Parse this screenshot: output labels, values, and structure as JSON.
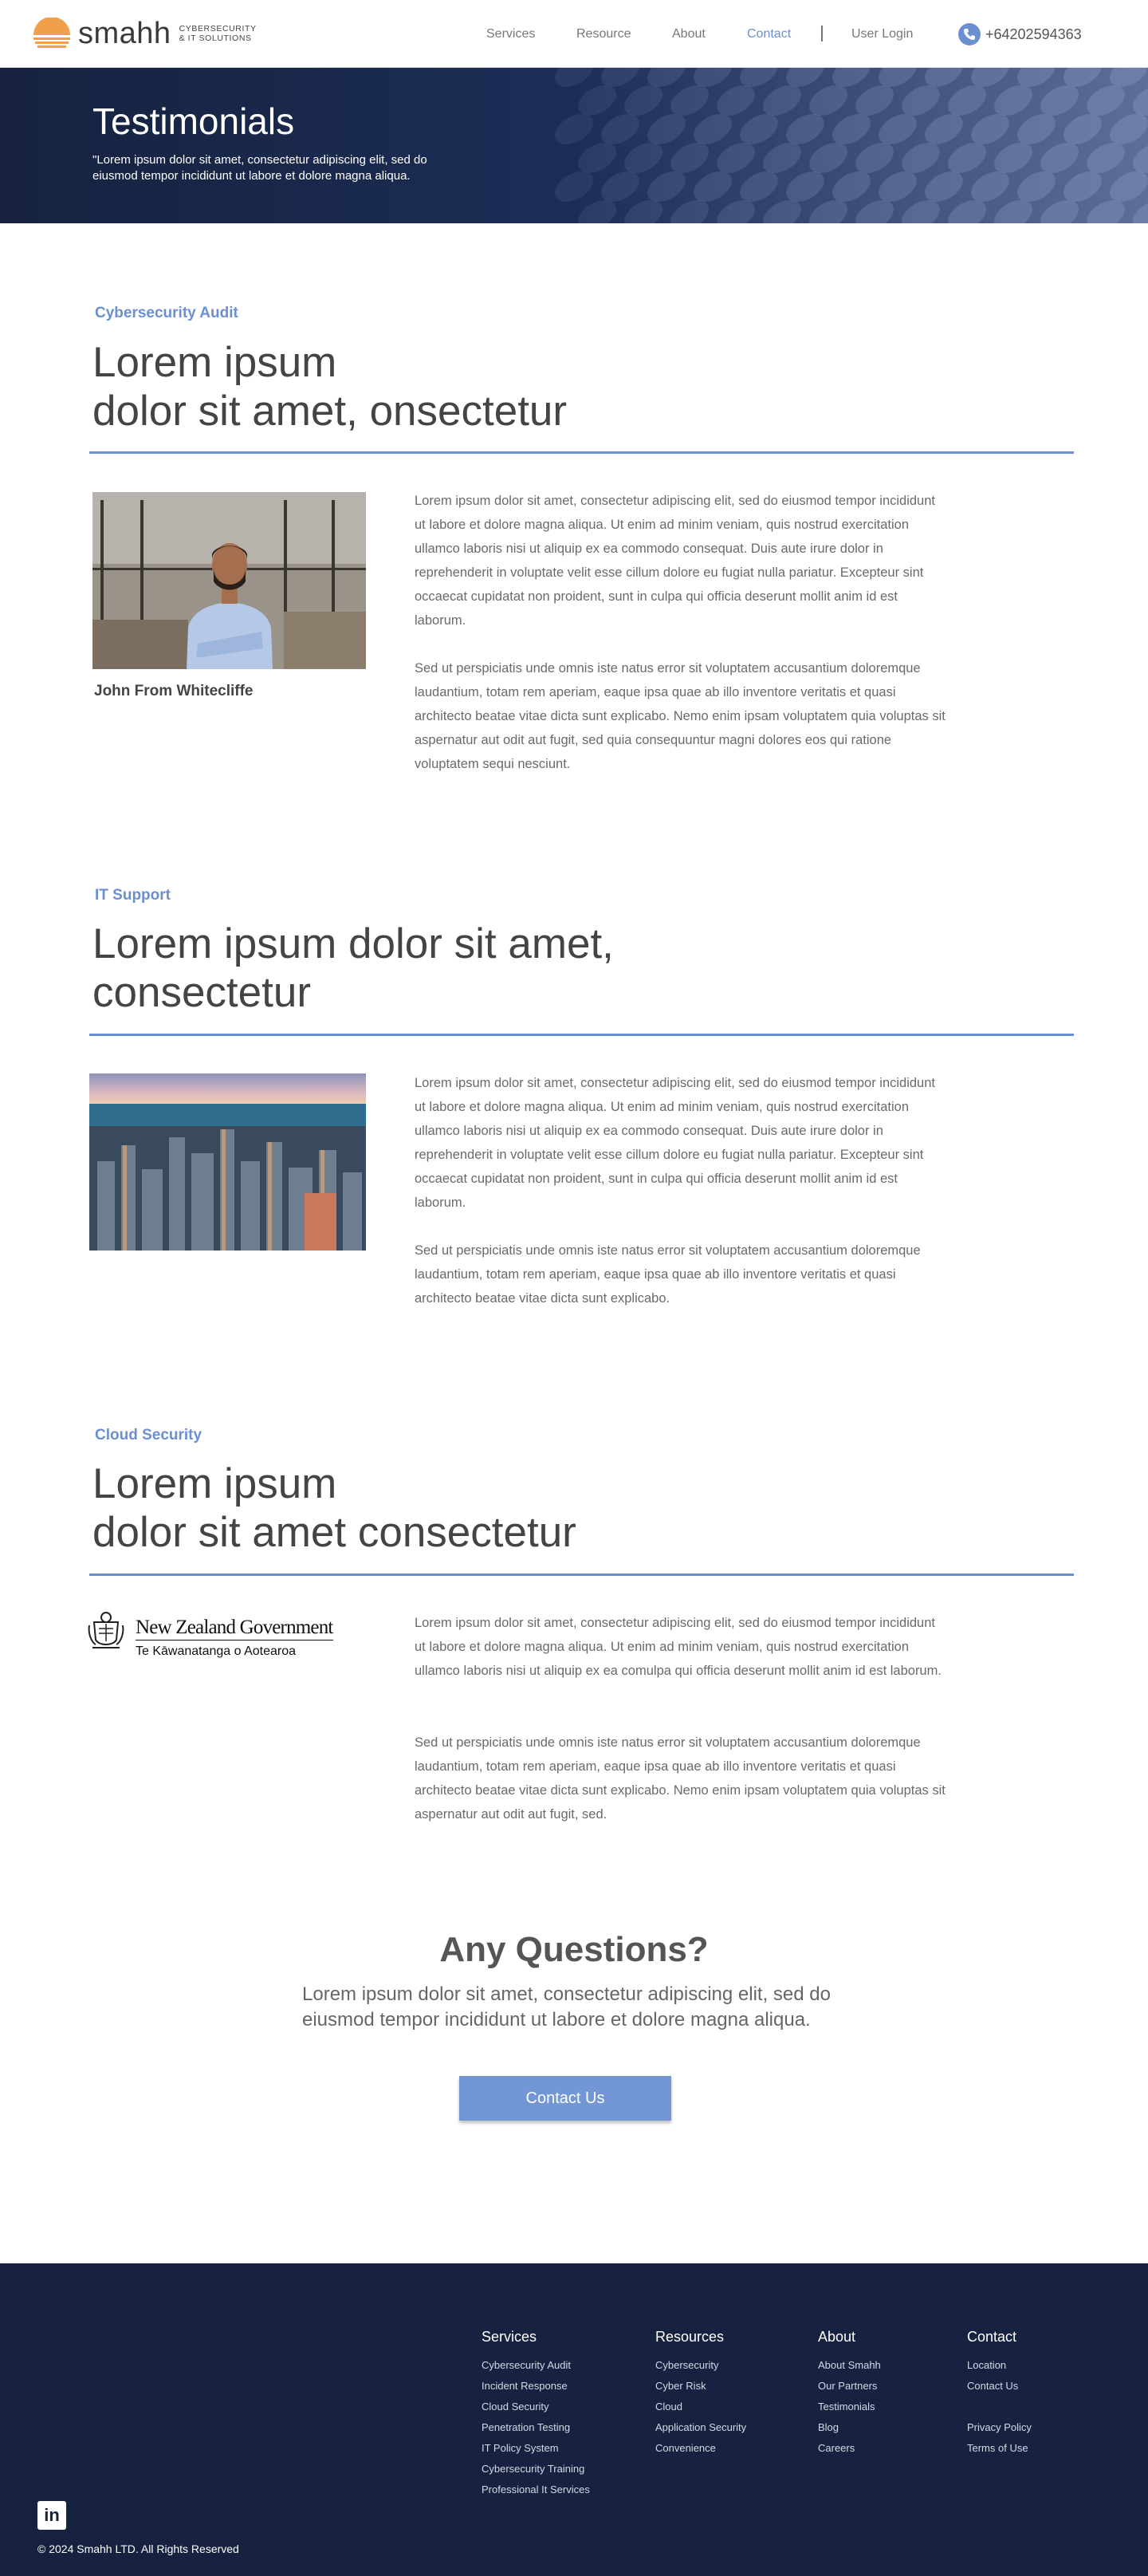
{
  "brand": {
    "name": "smahh",
    "tagline_1": "CYBERSECURITY",
    "tagline_2": "& IT SOLUTIONS"
  },
  "nav": {
    "items": [
      "Services",
      "Resource",
      "About",
      "Contact",
      "User Login"
    ],
    "active": "Contact",
    "phone": "+64202594363"
  },
  "hero": {
    "title": "Testimonials",
    "subtitle": "\"Lorem ipsum dolor sit amet, consectetur adipiscing elit, sed do eiusmod tempor incididunt ut labore et dolore magna aliqua."
  },
  "sections": [
    {
      "kicker": "Cybersecurity Audit",
      "title_line1": "Lorem ipsum",
      "title_line2": "dolor sit amet, onsectetur",
      "caption": "John From Whitecliffe",
      "para1": "Lorem ipsum dolor sit amet, consectetur adipiscing elit, sed do eiusmod tempor incididunt ut labore et dolore magna aliqua. Ut enim ad minim veniam, quis nostrud exercitation ullamco laboris nisi ut aliquip ex ea commodo consequat. Duis aute irure dolor in reprehenderit in voluptate velit esse cillum dolore eu fugiat nulla pariatur. Excepteur sint occaecat cupidatat non proident, sunt in culpa qui officia deserunt mollit anim id est laborum.",
      "para2": "Sed ut perspiciatis unde omnis iste natus error sit voluptatem accusantium doloremque laudantium, totam rem aperiam, eaque ipsa quae ab illo inventore veritatis et quasi architecto beatae vitae dicta sunt explicabo. Nemo enim ipsam voluptatem quia voluptas sit aspernatur aut odit aut fugit, sed quia consequuntur magni dolores eos qui ratione voluptatem sequi nesciunt."
    },
    {
      "kicker": "IT Support",
      "title_line1": "Lorem ipsum dolor sit amet,",
      "title_line2": "consectetur",
      "para1": "Lorem ipsum dolor sit amet, consectetur adipiscing elit, sed do eiusmod tempor incididunt ut labore et dolore magna aliqua. Ut enim ad minim veniam, quis nostrud exercitation ullamco laboris nisi ut aliquip ex ea commodo consequat. Duis aute irure dolor in reprehenderit in voluptate velit esse cillum dolore eu fugiat nulla pariatur. Excepteur sint occaecat cupidatat non proident, sunt in culpa qui officia deserunt mollit anim id est laborum.",
      "para2": "Sed ut perspiciatis unde omnis iste natus error sit voluptatem accusantium doloremque laudantium, totam rem aperiam, eaque ipsa quae ab illo inventore veritatis et quasi architecto beatae vitae dicta sunt explicabo."
    },
    {
      "kicker": "Cloud Security",
      "title_line1": "Lorem ipsum",
      "title_line2": "dolor sit amet consectetur",
      "logo_main": "New Zealand Government",
      "logo_sub": "Te Kāwanatanga o Aotearoa",
      "para1": "Lorem ipsum dolor sit amet, consectetur adipiscing elit, sed do eiusmod tempor incididunt ut labore et dolore magna aliqua. Ut enim ad minim veniam, quis nostrud exercitation ullamco laboris nisi ut aliquip ex ea comulpa qui officia deserunt mollit anim id est laborum.",
      "para2": "Sed ut perspiciatis unde omnis iste natus error sit voluptatem accusantium doloremque laudantium, totam rem aperiam, eaque ipsa quae ab illo inventore veritatis et quasi architecto beatae vitae dicta sunt explicabo. Nemo enim ipsam voluptatem quia voluptas sit aspernatur aut odit aut fugit, sed."
    }
  ],
  "questions": {
    "title": "Any Questions?",
    "subtitle": "Lorem ipsum dolor sit amet, consectetur adipiscing elit, sed do eiusmod tempor incididunt ut labore et dolore magna aliqua.",
    "button": "Contact Us"
  },
  "footer": {
    "columns": [
      {
        "title": "Services",
        "links": [
          "Cybersecurity Audit",
          "Incident Response",
          "Cloud Security",
          "Penetration Testing",
          "IT Policy System",
          "Cybersecurity Training",
          "Professional It Services"
        ]
      },
      {
        "title": "Resources",
        "links": [
          "Cybersecurity",
          "Cyber Risk",
          "Cloud",
          "Application Security",
          "Convenience"
        ]
      },
      {
        "title": "About",
        "links": [
          "About Smahh",
          "Our Partners",
          "Testimonials",
          "Blog",
          "Careers"
        ]
      },
      {
        "title": "Contact",
        "links": [
          "Location",
          "Contact Us",
          "",
          "Privacy Policy",
          "Terms of Use"
        ]
      }
    ],
    "copyright": "© 2024 Smahh LTD.  All Rights Reserved",
    "social_icon": "linkedin-icon"
  },
  "colors": {
    "accent": "#6b8fd0",
    "navy": "#16223f",
    "button": "#7396d4",
    "sun": "#f0a04a"
  }
}
